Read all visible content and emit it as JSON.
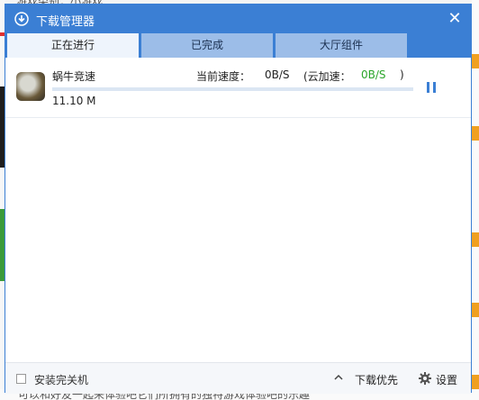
{
  "background": {
    "top_text": "游戏类别：小游戏",
    "bottom_text": "可以和好友一起来体验吧它们所拥有的独特游戏体验吧的乐趣"
  },
  "window": {
    "title": "下载管理器",
    "close_label": "✕"
  },
  "tabs": [
    {
      "label": "正在进行",
      "active": true
    },
    {
      "label": "已完成",
      "active": false
    },
    {
      "label": "大厅组件",
      "active": false
    }
  ],
  "downloads": [
    {
      "name": "蜗牛竞速",
      "speed_label": "当前速度：",
      "speed": "0B/S",
      "cloud_open": "(云加速：",
      "cloud_speed": "0B/S",
      "cloud_close": ")",
      "size": "11.10 M",
      "progress": 0
    }
  ],
  "footer": {
    "shutdown_label": "安装完关机",
    "priority_label": "下载优先",
    "settings_label": "设置"
  },
  "colors": {
    "accent": "#3b7fd4",
    "cloud_speed": "#2aa52a"
  }
}
